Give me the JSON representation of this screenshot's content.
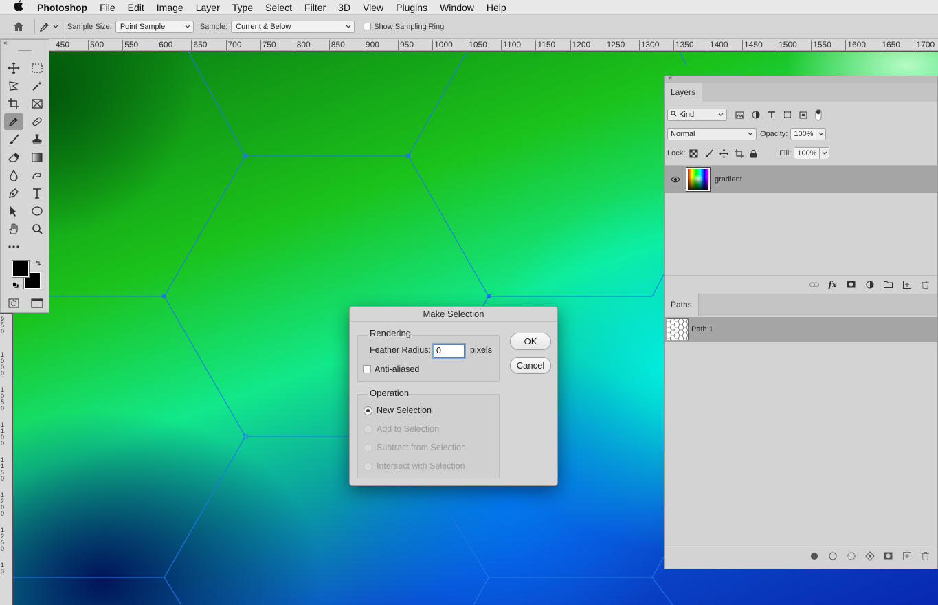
{
  "menubar": {
    "apple_symbol": "",
    "app_name": "Photoshop",
    "items": [
      "File",
      "Edit",
      "Image",
      "Layer",
      "Type",
      "Select",
      "Filter",
      "3D",
      "View",
      "Plugins",
      "Window",
      "Help"
    ]
  },
  "options_bar": {
    "sample_size_label": "Sample Size:",
    "sample_size_value": "Point Sample",
    "sample_label": "Sample:",
    "sample_value": "Current & Below",
    "show_sampling_ring_label": "Show Sampling Ring",
    "show_sampling_ring_checked": false
  },
  "ruler": {
    "h_ticks": [
      "450",
      "500",
      "550",
      "600",
      "650",
      "700",
      "750",
      "800",
      "850",
      "900",
      "950",
      "1000",
      "1050",
      "1100",
      "1150",
      "1200",
      "1250",
      "1300",
      "1350",
      "1400",
      "1450",
      "1500",
      "1550",
      "1600",
      "1650",
      "1700"
    ],
    "v_ticks": [
      [
        "9",
        "5",
        "0"
      ],
      [
        "1",
        "0",
        "0",
        "0"
      ],
      [
        "1",
        "0",
        "5",
        "0"
      ],
      [
        "1",
        "1",
        "0",
        "0"
      ],
      [
        "1",
        "1",
        "5",
        "0"
      ],
      [
        "1",
        "2",
        "0",
        "0"
      ],
      [
        "1",
        "2",
        "5",
        "0"
      ],
      [
        "1",
        "3"
      ]
    ]
  },
  "layers_panel": {
    "tab": "Layers",
    "filter_kind": "Kind",
    "blend_mode": "Normal",
    "opacity_label": "Opacity:",
    "opacity_value": "100%",
    "lock_label": "Lock:",
    "fill_label": "Fill:",
    "fill_value": "100%",
    "layers": [
      {
        "name": "gradient",
        "visible": true
      }
    ]
  },
  "paths_panel": {
    "tab": "Paths",
    "paths": [
      {
        "name": "Path 1"
      }
    ]
  },
  "dialog": {
    "title": "Make Selection",
    "rendering_label": "Rendering",
    "feather_label": "Feather Radius:",
    "feather_value": "0",
    "feather_unit": "pixels",
    "anti_aliased_label": "Anti-aliased",
    "anti_aliased_checked": false,
    "operation_label": "Operation",
    "operations": [
      {
        "label": "New Selection",
        "selected": true,
        "enabled": true
      },
      {
        "label": "Add to Selection",
        "selected": false,
        "enabled": false
      },
      {
        "label": "Subtract from Selection",
        "selected": false,
        "enabled": false
      },
      {
        "label": "Intersect with Selection",
        "selected": false,
        "enabled": false
      }
    ],
    "ok_label": "OK",
    "cancel_label": "Cancel"
  },
  "colors": {
    "path_stroke": "#1e78e6",
    "foreground": "#000000",
    "background": "#000000",
    "feather_focus": "#3b82f6"
  }
}
